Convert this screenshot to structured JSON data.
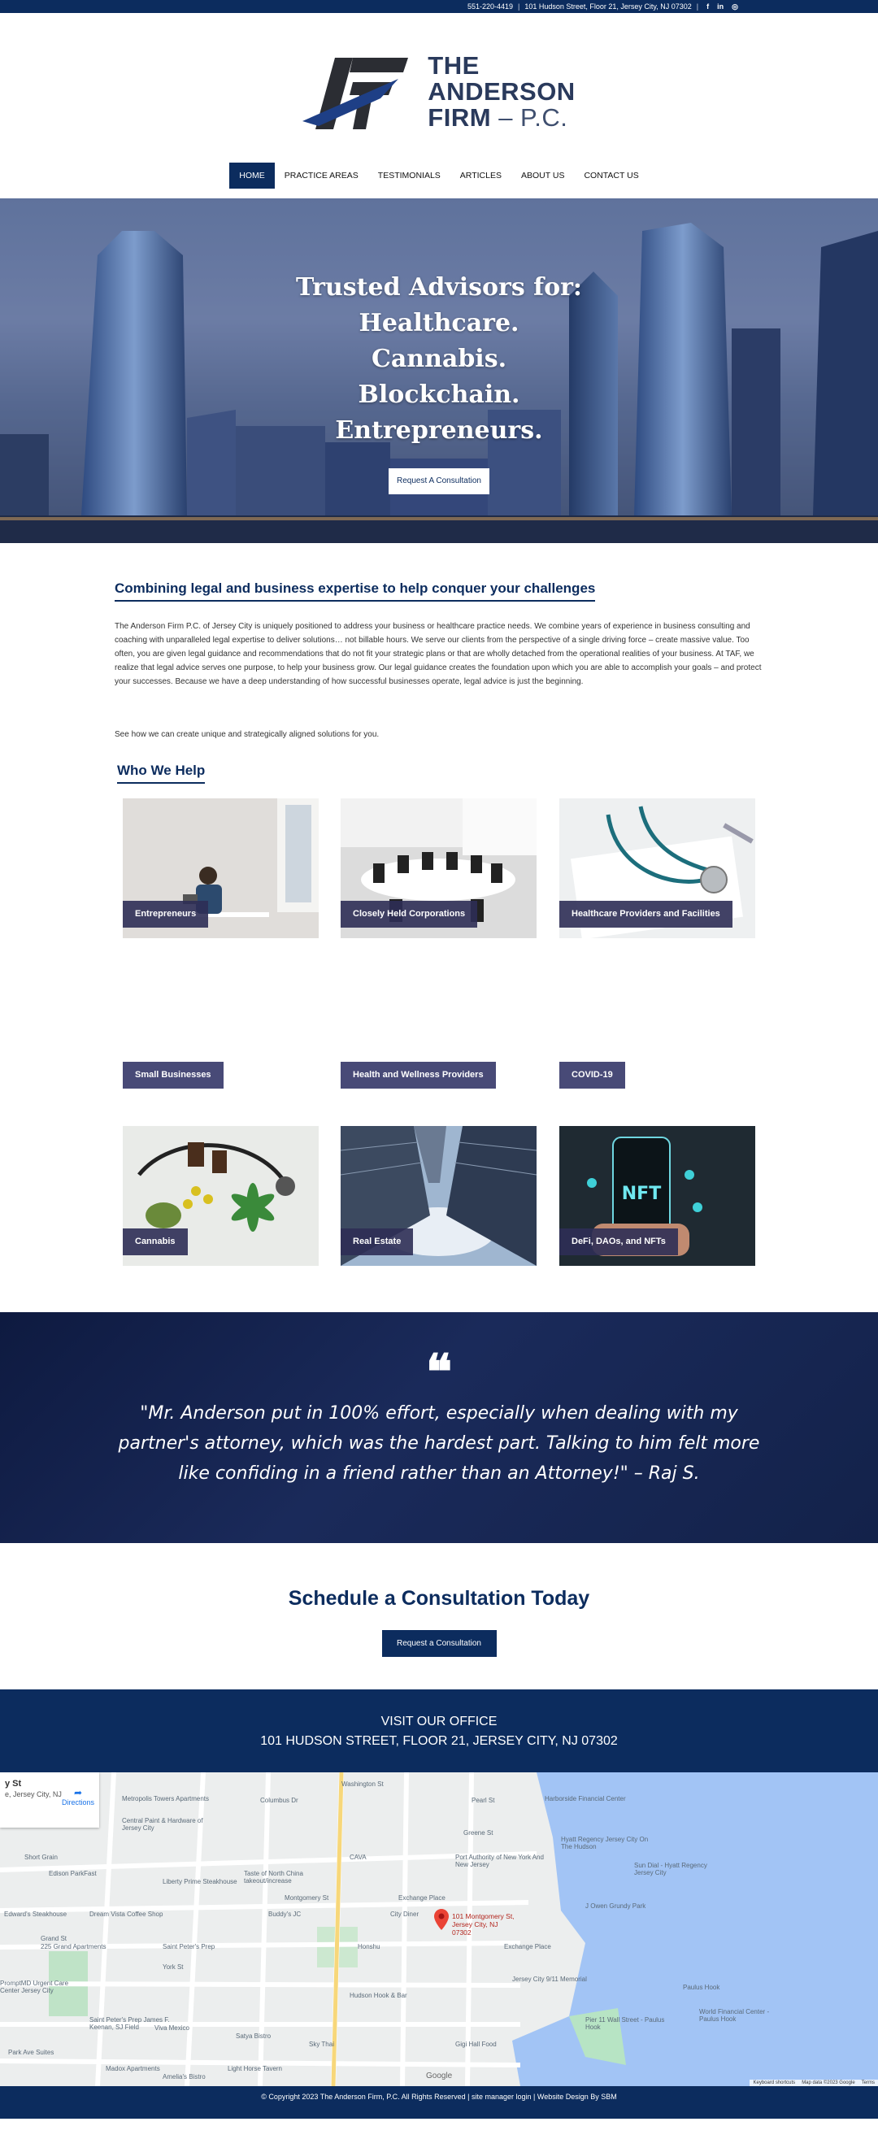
{
  "topbar": {
    "phone": "551-220-4419",
    "address": "101 Hudson Street, Floor 21, Jersey City, NJ 07302",
    "social": [
      "f",
      "in",
      "◎"
    ]
  },
  "logo": {
    "line1": "THE",
    "line2": "ANDERSON",
    "line3": "FIRM",
    "line3_suffix": "– P.C."
  },
  "nav": [
    "HOME",
    "PRACTICE AREAS",
    "TESTIMONIALS",
    "ARTICLES",
    "ABOUT US",
    "CONTACT US"
  ],
  "hero": {
    "lines": [
      "Trusted Advisors for:",
      "Healthcare.",
      "Cannabis.",
      "Blockchain.",
      "Entrepreneurs."
    ],
    "button": "Request A Consultation"
  },
  "intro": {
    "heading": "Combining legal and business expertise to help conquer your challenges",
    "body": "The Anderson Firm P.C. of Jersey City is uniquely positioned to address your business or healthcare practice needs. We combine years of experience in business consulting and coaching with unparalleled legal expertise to deliver solutions… not billable hours. We serve our clients from the perspective of a single driving force – create massive value. Too often, you are given legal guidance and recommendations that do not fit your strategic plans or that are wholly detached from the operational realities of your business. At TAF, we realize that legal advice serves one purpose, to help your business grow.  Our legal guidance creates the foundation upon which you are able to accomplish your goals – and protect your successes. Because we have a deep understanding of how successful businesses operate, legal advice is just the beginning.",
    "see_how": "See how we can create unique and strategically aligned solutions for you."
  },
  "who": {
    "heading": "Who We Help",
    "row1": [
      "Entrepreneurs",
      "Closely Held Corporations",
      "Healthcare Providers and Facilities"
    ],
    "row2": [
      "Small Businesses",
      "Health and Wellness Providers",
      "COVID-19"
    ],
    "row3": [
      "Cannabis",
      "Real Estate",
      "DeFi, DAOs, and NFTs"
    ]
  },
  "testimonial": {
    "mark": "❝",
    "text": "\"Mr. Anderson put in 100% effort, especially when dealing with my partner's attorney, which was the hardest part. Talking to him felt more like confiding in a friend rather than an Attorney!\" – Raj S."
  },
  "schedule": {
    "heading": "Schedule a Consultation Today",
    "button": "Request a Consultation"
  },
  "visit": {
    "line1": "VISIT OUR OFFICE",
    "line2": "101 HUDSON STREET, FLOOR 21, JERSEY CITY, NJ 07302"
  },
  "map": {
    "card_title": "y St",
    "card_sub": "e, Jersey City, NJ",
    "directions": "Directions",
    "pin_label": "101 Montgomery St, Jersey City, NJ 07302",
    "places": [
      "Metropolis Towers Apartments",
      "Harborside Financial Center",
      "Central Paint & Hardware of Jersey City",
      "Hyatt Regency Jersey City On The Hudson",
      "Short Grain",
      "Edison ParkFast",
      "Liberty Prime Steakhouse",
      "Taste of North China takeout/increase",
      "CAVA",
      "Port Authority of New York And New Jersey",
      "Exchange Place",
      "Sun Dial - Hyatt Regency Jersey City",
      "J Owen Grundy Park",
      "Edward's Steakhouse",
      "Dream Vista Coffee Shop",
      "Buddy's JC",
      "City Diner",
      "225 Grand Apartments",
      "Saint Peter's Prep",
      "Honshu",
      "Exchange Place",
      "Jersey City 9/11 Memorial",
      "PromptMD Urgent Care Center Jersey City",
      "Saint Peter's Prep James F. Keenan, SJ Field",
      "Viva Mexico",
      "Satya Bistro",
      "Sky Thai",
      "Gigi Hall Food",
      "Park Ave Suites",
      "Madox Apartments",
      "Amelia's Bistro",
      "Light Horse Tavern",
      "Hudson Hook & Bar",
      "Paulus Hook",
      "Pier 11 Wall Street - Paulus Hook",
      "World Financial Center - Paulus Hook",
      "Grand St",
      "York St",
      "Montgomery St",
      "Columbus Dr",
      "Washington St",
      "Greene St",
      "Pearl St"
    ],
    "google": "Google",
    "attrib": [
      "Keyboard shortcuts",
      "Map data ©2023 Google",
      "Terms"
    ]
  },
  "footer": {
    "text": "© Copyright 2023 The Anderson Firm, P.C. All Rights Reserved | site manager login | Website Design By SBM"
  },
  "colors": {
    "navy": "#0c2c5e",
    "label_purple": "#484a77"
  }
}
